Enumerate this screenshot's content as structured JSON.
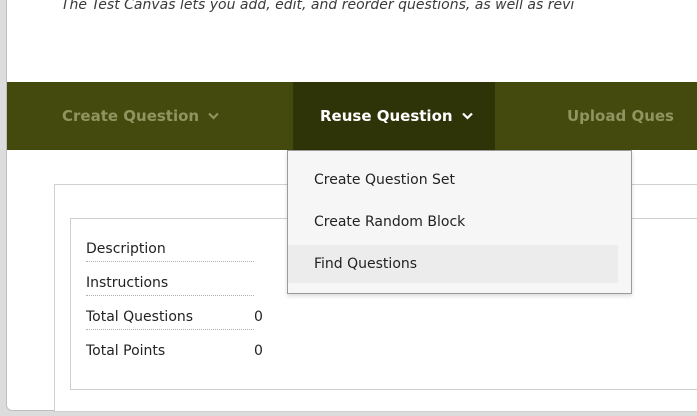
{
  "intro": {
    "text": "The Test Canvas lets you add, edit, and reorder questions, as well as revi"
  },
  "nav": {
    "tabs": [
      {
        "label": "Create Question",
        "icon": "chevron-down-icon"
      },
      {
        "label": "Reuse Question",
        "icon": "chevron-down-icon"
      },
      {
        "label": "Upload Ques"
      }
    ]
  },
  "dropdown": {
    "items": [
      {
        "label": "Create Question Set"
      },
      {
        "label": "Create Random Block"
      },
      {
        "label": "Find Questions"
      }
    ]
  },
  "info": {
    "rows": [
      {
        "label": "Description",
        "value": ""
      },
      {
        "label": "Instructions",
        "value": ""
      },
      {
        "label": "Total Questions",
        "value": "0"
      },
      {
        "label": "Total Points",
        "value": "0"
      }
    ]
  },
  "colors": {
    "navbar": "#44490d",
    "active_tab": "#2f3308",
    "inactive_tab_text": "#8f9460"
  }
}
